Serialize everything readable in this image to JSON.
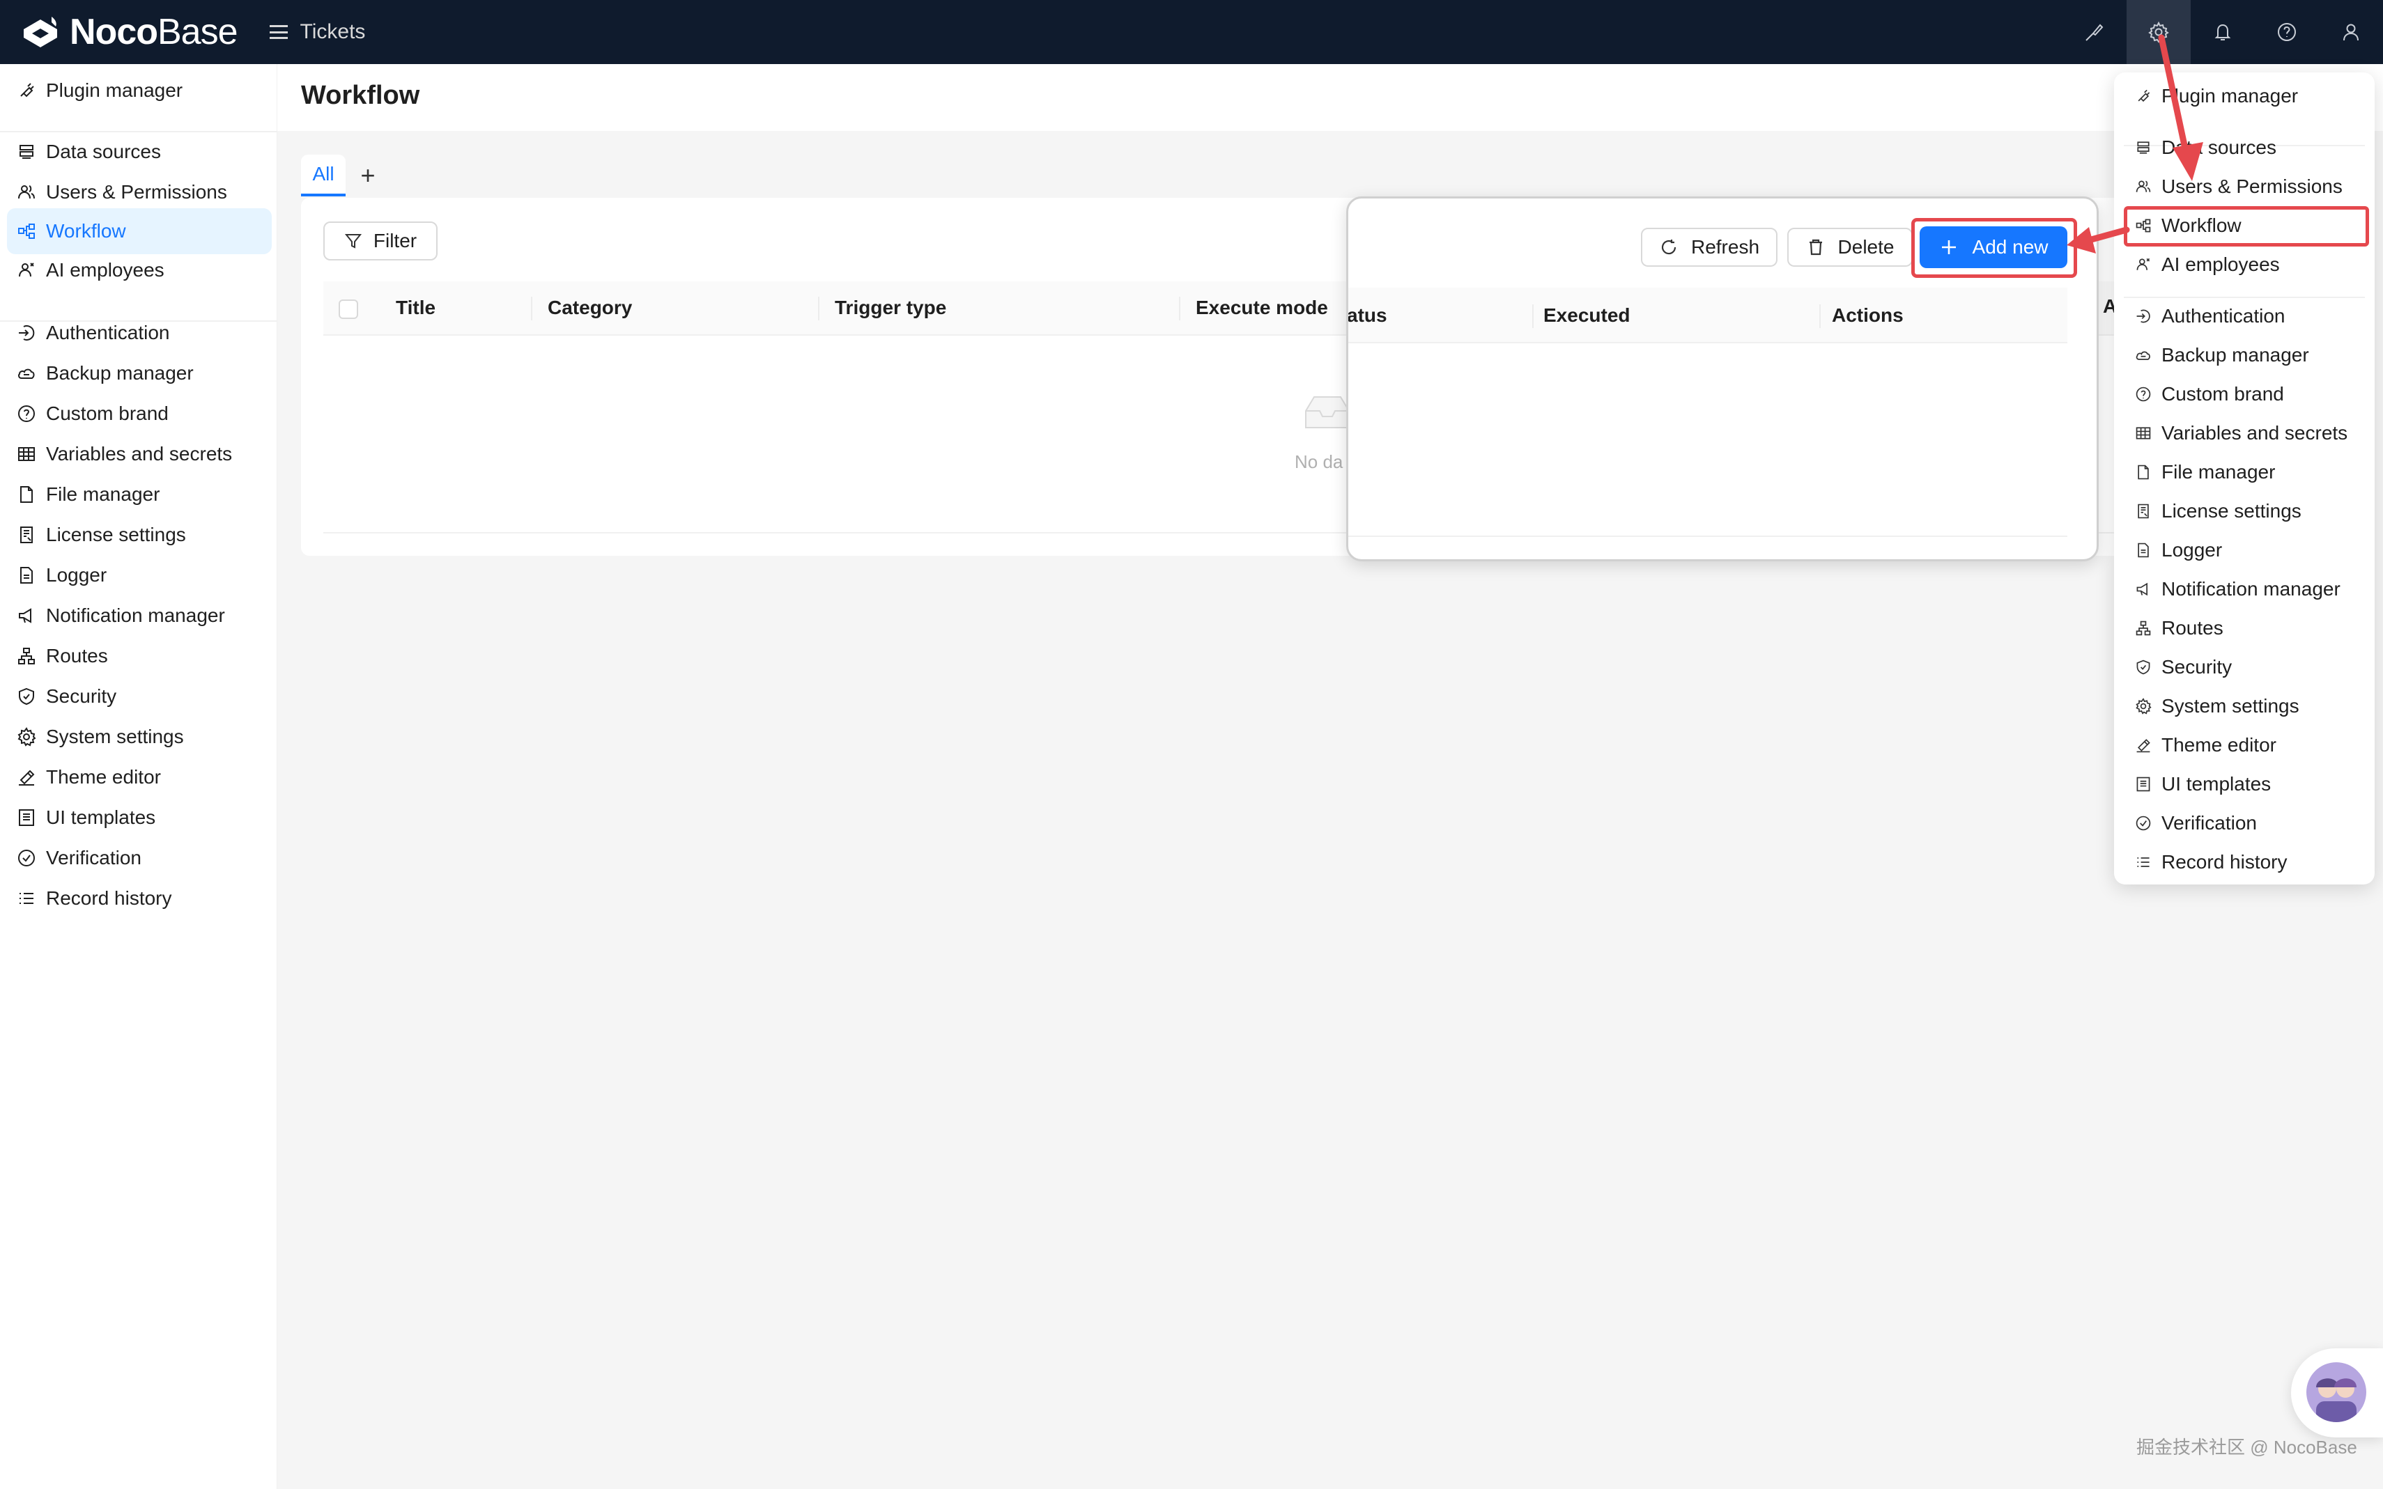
{
  "brand": {
    "name_bold": "Noco",
    "name_light": "Base"
  },
  "header": {
    "menu_label": "Tickets"
  },
  "top_icons": [
    "brush-icon",
    "gear-icon",
    "bell-icon",
    "help-icon",
    "user-icon"
  ],
  "sidebar": {
    "items": [
      {
        "label": "Plugin manager",
        "icon": "plugin-icon"
      },
      {
        "label": "Data sources",
        "icon": "database-icon"
      },
      {
        "label": "Users & Permissions",
        "icon": "users-icon"
      },
      {
        "label": "Workflow",
        "icon": "workflow-icon",
        "active": true
      },
      {
        "label": "AI employees",
        "icon": "ai-icon"
      },
      {
        "label": "Authentication",
        "icon": "login-icon"
      },
      {
        "label": "Backup manager",
        "icon": "cloud-icon"
      },
      {
        "label": "Custom brand",
        "icon": "question-icon"
      },
      {
        "label": "Variables and secrets",
        "icon": "table-icon"
      },
      {
        "label": "File manager",
        "icon": "file-icon"
      },
      {
        "label": "License settings",
        "icon": "license-icon"
      },
      {
        "label": "Logger",
        "icon": "log-icon"
      },
      {
        "label": "Notification manager",
        "icon": "megaphone-icon"
      },
      {
        "label": "Routes",
        "icon": "routes-icon"
      },
      {
        "label": "Security",
        "icon": "shield-icon"
      },
      {
        "label": "System settings",
        "icon": "gear-icon"
      },
      {
        "label": "Theme editor",
        "icon": "paint-icon"
      },
      {
        "label": "UI templates",
        "icon": "template-icon"
      },
      {
        "label": "Verification",
        "icon": "check-circle-icon"
      },
      {
        "label": "Record history",
        "icon": "list-icon"
      }
    ]
  },
  "page": {
    "title": "Workflow"
  },
  "tabs": {
    "all_label": "All",
    "add_label": "+"
  },
  "toolbar": {
    "filter_label": "Filter"
  },
  "table": {
    "columns": [
      "Title",
      "Category",
      "Trigger type",
      "Execute mode"
    ],
    "empty_text": "No da"
  },
  "zoom": {
    "refresh_label": "Refresh",
    "delete_label": "Delete",
    "add_new_label": "Add new",
    "columns": [
      "atus",
      "Executed",
      "Actions"
    ],
    "edge_char": "A"
  },
  "dropdown": {
    "items": [
      "Plugin manager",
      "Data sources",
      "Users & Permissions",
      "Workflow",
      "AI employees",
      "Authentication",
      "Backup manager",
      "Custom brand",
      "Variables and secrets",
      "File manager",
      "License settings",
      "Logger",
      "Notification manager",
      "Routes",
      "Security",
      "System settings",
      "Theme editor",
      "UI templates",
      "Verification",
      "Record history"
    ],
    "display": [
      "Plugin manager",
      "Data sources",
      "Users & Permissions"
    ]
  },
  "watermark": "掘金技术社区 @ NocoBase",
  "colors": {
    "accent": "#1677ff",
    "annotation": "#e5484d",
    "topbar": "#0f1b2d"
  }
}
